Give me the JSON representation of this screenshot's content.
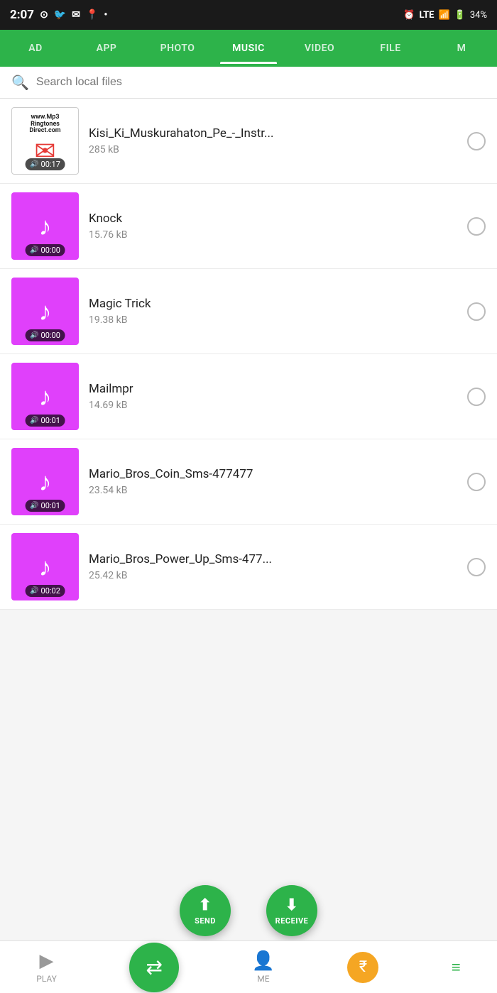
{
  "status": {
    "time": "2:07",
    "signal": "LTE",
    "battery": "34%"
  },
  "tabs": [
    {
      "label": "AD",
      "active": false
    },
    {
      "label": "APP",
      "active": false
    },
    {
      "label": "PHOTO",
      "active": false
    },
    {
      "label": "MUSIC",
      "active": true
    },
    {
      "label": "VIDEO",
      "active": false
    },
    {
      "label": "FILE",
      "active": false
    },
    {
      "label": "M",
      "active": false
    }
  ],
  "search": {
    "placeholder": "Search local files"
  },
  "files": [
    {
      "id": 1,
      "name": "Kisi_Ki_Muskurahaton_Pe_-_Instr...",
      "size": "285 kB",
      "duration": "00:17",
      "thumb_type": "ringtones"
    },
    {
      "id": 2,
      "name": "Knock",
      "size": "15.76 kB",
      "duration": "00:00",
      "thumb_type": "music"
    },
    {
      "id": 3,
      "name": "Magic Trick",
      "size": "19.38 kB",
      "duration": "00:00",
      "thumb_type": "music"
    },
    {
      "id": 4,
      "name": "Mailmpr",
      "size": "14.69 kB",
      "duration": "00:01",
      "thumb_type": "music"
    },
    {
      "id": 5,
      "name": "Mario_Bros_Coin_Sms-477477",
      "size": "23.54 kB",
      "duration": "00:01",
      "thumb_type": "music"
    },
    {
      "id": 6,
      "name": "Mario_Bros_Power_Up_Sms-477...",
      "size": "25.42 kB",
      "duration": "00:02",
      "thumb_type": "music"
    }
  ],
  "fab": {
    "send_label": "SEND",
    "receive_label": "RECEIVE"
  },
  "bottom_nav": {
    "play_label": "PLAY",
    "me_label": "ME"
  },
  "ringtones": {
    "line1": "Ringtones",
    "line2": "Direct.com",
    "website": "www.Mp3"
  }
}
